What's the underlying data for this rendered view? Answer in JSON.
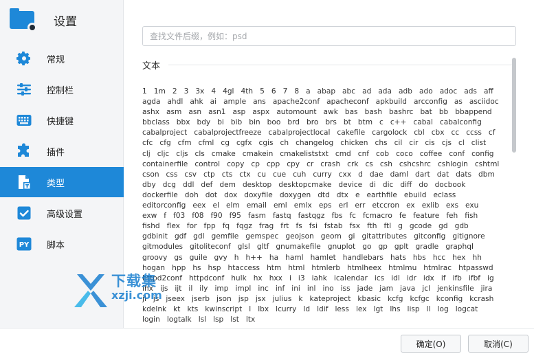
{
  "sidebar": {
    "title": "设置",
    "items": [
      {
        "label": "常规",
        "icon": "gear-icon"
      },
      {
        "label": "控制栏",
        "icon": "sliders-icon"
      },
      {
        "label": "快捷键",
        "icon": "keyboard-icon"
      },
      {
        "label": "插件",
        "icon": "puzzle-icon"
      },
      {
        "label": "类型",
        "icon": "file-type-icon",
        "active": true
      },
      {
        "label": "高级设置",
        "icon": "checkbox-icon"
      },
      {
        "label": "脚本",
        "icon": "python-icon",
        "badge": "PY"
      }
    ]
  },
  "search": {
    "placeholder": "查找文件后缀，例如：psd"
  },
  "section": {
    "title": "文本"
  },
  "extensions": [
    "1",
    "1m",
    "2",
    "3",
    "3x",
    "4",
    "4gl",
    "4th",
    "5",
    "6",
    "7",
    "8",
    "a",
    "abap",
    "abc",
    "ad",
    "ada",
    "adb",
    "ado",
    "adoc",
    "ads",
    "aff",
    "agda",
    "ahdl",
    "ahk",
    "ai",
    "ample",
    "ans",
    "apache2conf",
    "apacheconf",
    "apkbuild",
    "arcconfig",
    "as",
    "asciidoc",
    "ashx",
    "asm",
    "asn",
    "asn1",
    "asp",
    "aspx",
    "automount",
    "awk",
    "bas",
    "bash",
    "bashrc",
    "bat",
    "bb",
    "bbappend",
    "bbclass",
    "bbx",
    "bdy",
    "bi",
    "bib",
    "bin",
    "boo",
    "brd",
    "bro",
    "brs",
    "bt",
    "btm",
    "c",
    "c++",
    "cabal",
    "cabalconfig",
    "cabalproject",
    "cabalprojectfreeze",
    "cabalprojectlocal",
    "cakefile",
    "cargolock",
    "cbl",
    "cbx",
    "cc",
    "ccss",
    "cf",
    "cfc",
    "cfg",
    "cfm",
    "cfml",
    "cg",
    "cgfx",
    "cgis",
    "ch",
    "changelog",
    "chicken",
    "chs",
    "cil",
    "cir",
    "cis",
    "cjs",
    "cl",
    "clist",
    "clj",
    "cljc",
    "cljs",
    "cls",
    "cmake",
    "cmakein",
    "cmakeliststxt",
    "cmd",
    "cnf",
    "cob",
    "coco",
    "coffee",
    "conf",
    "config",
    "containerfile",
    "control",
    "copy",
    "cp",
    "cpp",
    "cpy",
    "cr",
    "crash",
    "crk",
    "cs",
    "csh",
    "cshcshrc",
    "cshlogin",
    "cshtml",
    "cson",
    "css",
    "csv",
    "ctp",
    "cts",
    "ctx",
    "cu",
    "cue",
    "cuh",
    "curry",
    "cxx",
    "d",
    "dae",
    "daml",
    "dart",
    "dat",
    "dats",
    "dbm",
    "dby",
    "dcg",
    "ddl",
    "def",
    "dem",
    "desktop",
    "desktopcmake",
    "device",
    "di",
    "dic",
    "diff",
    "do",
    "docbook",
    "dockerfile",
    "doh",
    "dot",
    "dox",
    "doxyfile",
    "doxygen",
    "dtd",
    "dtx",
    "e",
    "earthfile",
    "ebuild",
    "eclass",
    "editorconfig",
    "eex",
    "el",
    "elm",
    "email",
    "eml",
    "emlx",
    "eps",
    "erl",
    "err",
    "etccron",
    "ex",
    "exlib",
    "exs",
    "exu",
    "exw",
    "f",
    "f03",
    "f08",
    "f90",
    "f95",
    "fasm",
    "fastq",
    "fastqgz",
    "fbs",
    "fc",
    "fcmacro",
    "fe",
    "feature",
    "feh",
    "fish",
    "fishd",
    "flex",
    "for",
    "fpp",
    "fq",
    "fqgz",
    "frag",
    "frt",
    "fs",
    "fsi",
    "fstab",
    "fsx",
    "fth",
    "ftl",
    "g",
    "gcode",
    "gd",
    "gdb",
    "gdbinit",
    "gdf",
    "gdl",
    "gemfile",
    "gemspec",
    "geojson",
    "geom",
    "gi",
    "gitattributes",
    "gitconfig",
    "gitignore",
    "gitmodules",
    "gitoliteconf",
    "glsl",
    "gltf",
    "gnumakefile",
    "gnuplot",
    "go",
    "gp",
    "gplt",
    "gradle",
    "graphql",
    "groovy",
    "gs",
    "guile",
    "gvy",
    "h",
    "h++",
    "ha",
    "haml",
    "hamlet",
    "handlebars",
    "hats",
    "hbs",
    "hcc",
    "hex",
    "hh",
    "hogan",
    "hpp",
    "hs",
    "hsp",
    "htaccess",
    "htm",
    "html",
    "htmlerb",
    "htmlheex",
    "htmlmu",
    "htmlrac",
    "htpasswd",
    "httpd2conf",
    "httpdconf",
    "hulk",
    "hx",
    "hxx",
    "i",
    "i3",
    "iahk",
    "icalendar",
    "ics",
    "idl",
    "idr",
    "idx",
    "if",
    "ifb",
    "ifbf",
    "ig",
    "ihx",
    "ijs",
    "ijt",
    "il",
    "ily",
    "imp",
    "impl",
    "inc",
    "inf",
    "ini",
    "inl",
    "ino",
    "iss",
    "jade",
    "jam",
    "java",
    "jcl",
    "jenkinsfile",
    "jira",
    "jl",
    "js",
    "jseex",
    "jserb",
    "json",
    "jsp",
    "jsx",
    "julius",
    "k",
    "kateproject",
    "kbasic",
    "kcfg",
    "kcfgc",
    "kconfig",
    "kcrash",
    "kdelnk",
    "kt",
    "kts",
    "kwinscript",
    "l",
    "lbx",
    "lcurry",
    "ld",
    "ldif",
    "less",
    "lex",
    "lgt",
    "lhs",
    "lisp",
    "ll",
    "log",
    "logcat",
    "login",
    "logtalk",
    "lsl",
    "lsp",
    "lst",
    "ltx"
  ],
  "buttons": {
    "ok": "确定(O)",
    "cancel": "取消(C)"
  },
  "watermark": {
    "text": "下载集",
    "url": "xzji.com"
  },
  "colors": {
    "accent": "#1e88d8",
    "sidebar_bg": "#f4f5f7"
  }
}
